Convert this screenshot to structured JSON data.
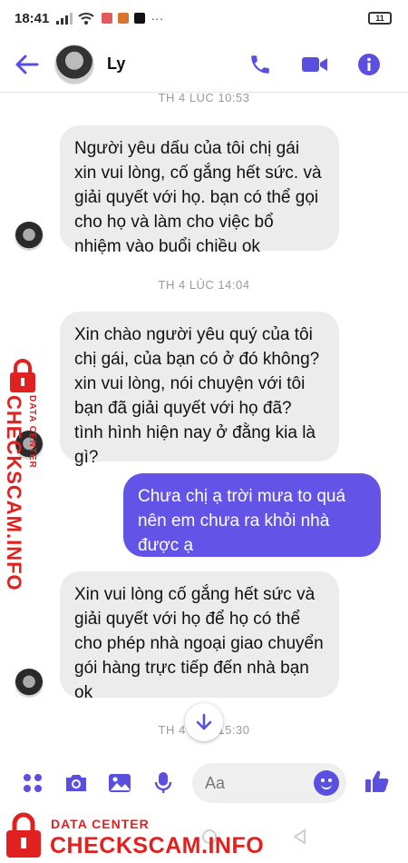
{
  "status_bar": {
    "time": "18:41",
    "battery": "11"
  },
  "header": {
    "contact_name": "Ly"
  },
  "messages": [
    {
      "type": "timestamp",
      "text": "TH 4 LÚC 10:53"
    },
    {
      "type": "incoming",
      "text": "Người yêu dấu của tôi chị gái xin vui lòng, cố gắng hết sức. và giải quyết với họ. bạn có thể gọi cho họ và làm cho việc bổ nhiệm vào buổi chiều ok"
    },
    {
      "type": "timestamp",
      "text": "TH 4 LÚC 14:04"
    },
    {
      "type": "incoming",
      "text": "Xin chào người yêu quý của tôi chị gái, của bạn có ở đó không? xin vui lòng, nói chuyện với tôi bạn đã giải quyết với họ đã? tình hình hiện nay ở đằng kia là gì?"
    },
    {
      "type": "outgoing",
      "text": "Chưa chị ạ  trời mưa to quá nên em chưa ra khỏi nhà được ạ"
    },
    {
      "type": "incoming",
      "text": "Xin vui lòng cố gắng hết sức và giải quyết với họ để họ có thể cho phép nhà ngoại giao chuyển gói hàng trực tiếp đến nhà bạn ok"
    },
    {
      "type": "timestamp",
      "text": "TH 4 LÚC 15:30"
    }
  ],
  "composer": {
    "placeholder": "Aa"
  },
  "watermark": {
    "line1": "DATA CENTER",
    "line2": "CHECKSCAM.INFO"
  },
  "colors": {
    "accent": "#6353e6",
    "incoming_bubble": "#ececec",
    "watermark": "#e0211f"
  },
  "icons": [
    "back-arrow-icon",
    "phone-icon",
    "video-icon",
    "info-icon",
    "chevron-down-icon",
    "apps-icon",
    "camera-icon",
    "image-icon",
    "mic-icon",
    "emoji-icon",
    "like-icon",
    "lock-icon"
  ]
}
